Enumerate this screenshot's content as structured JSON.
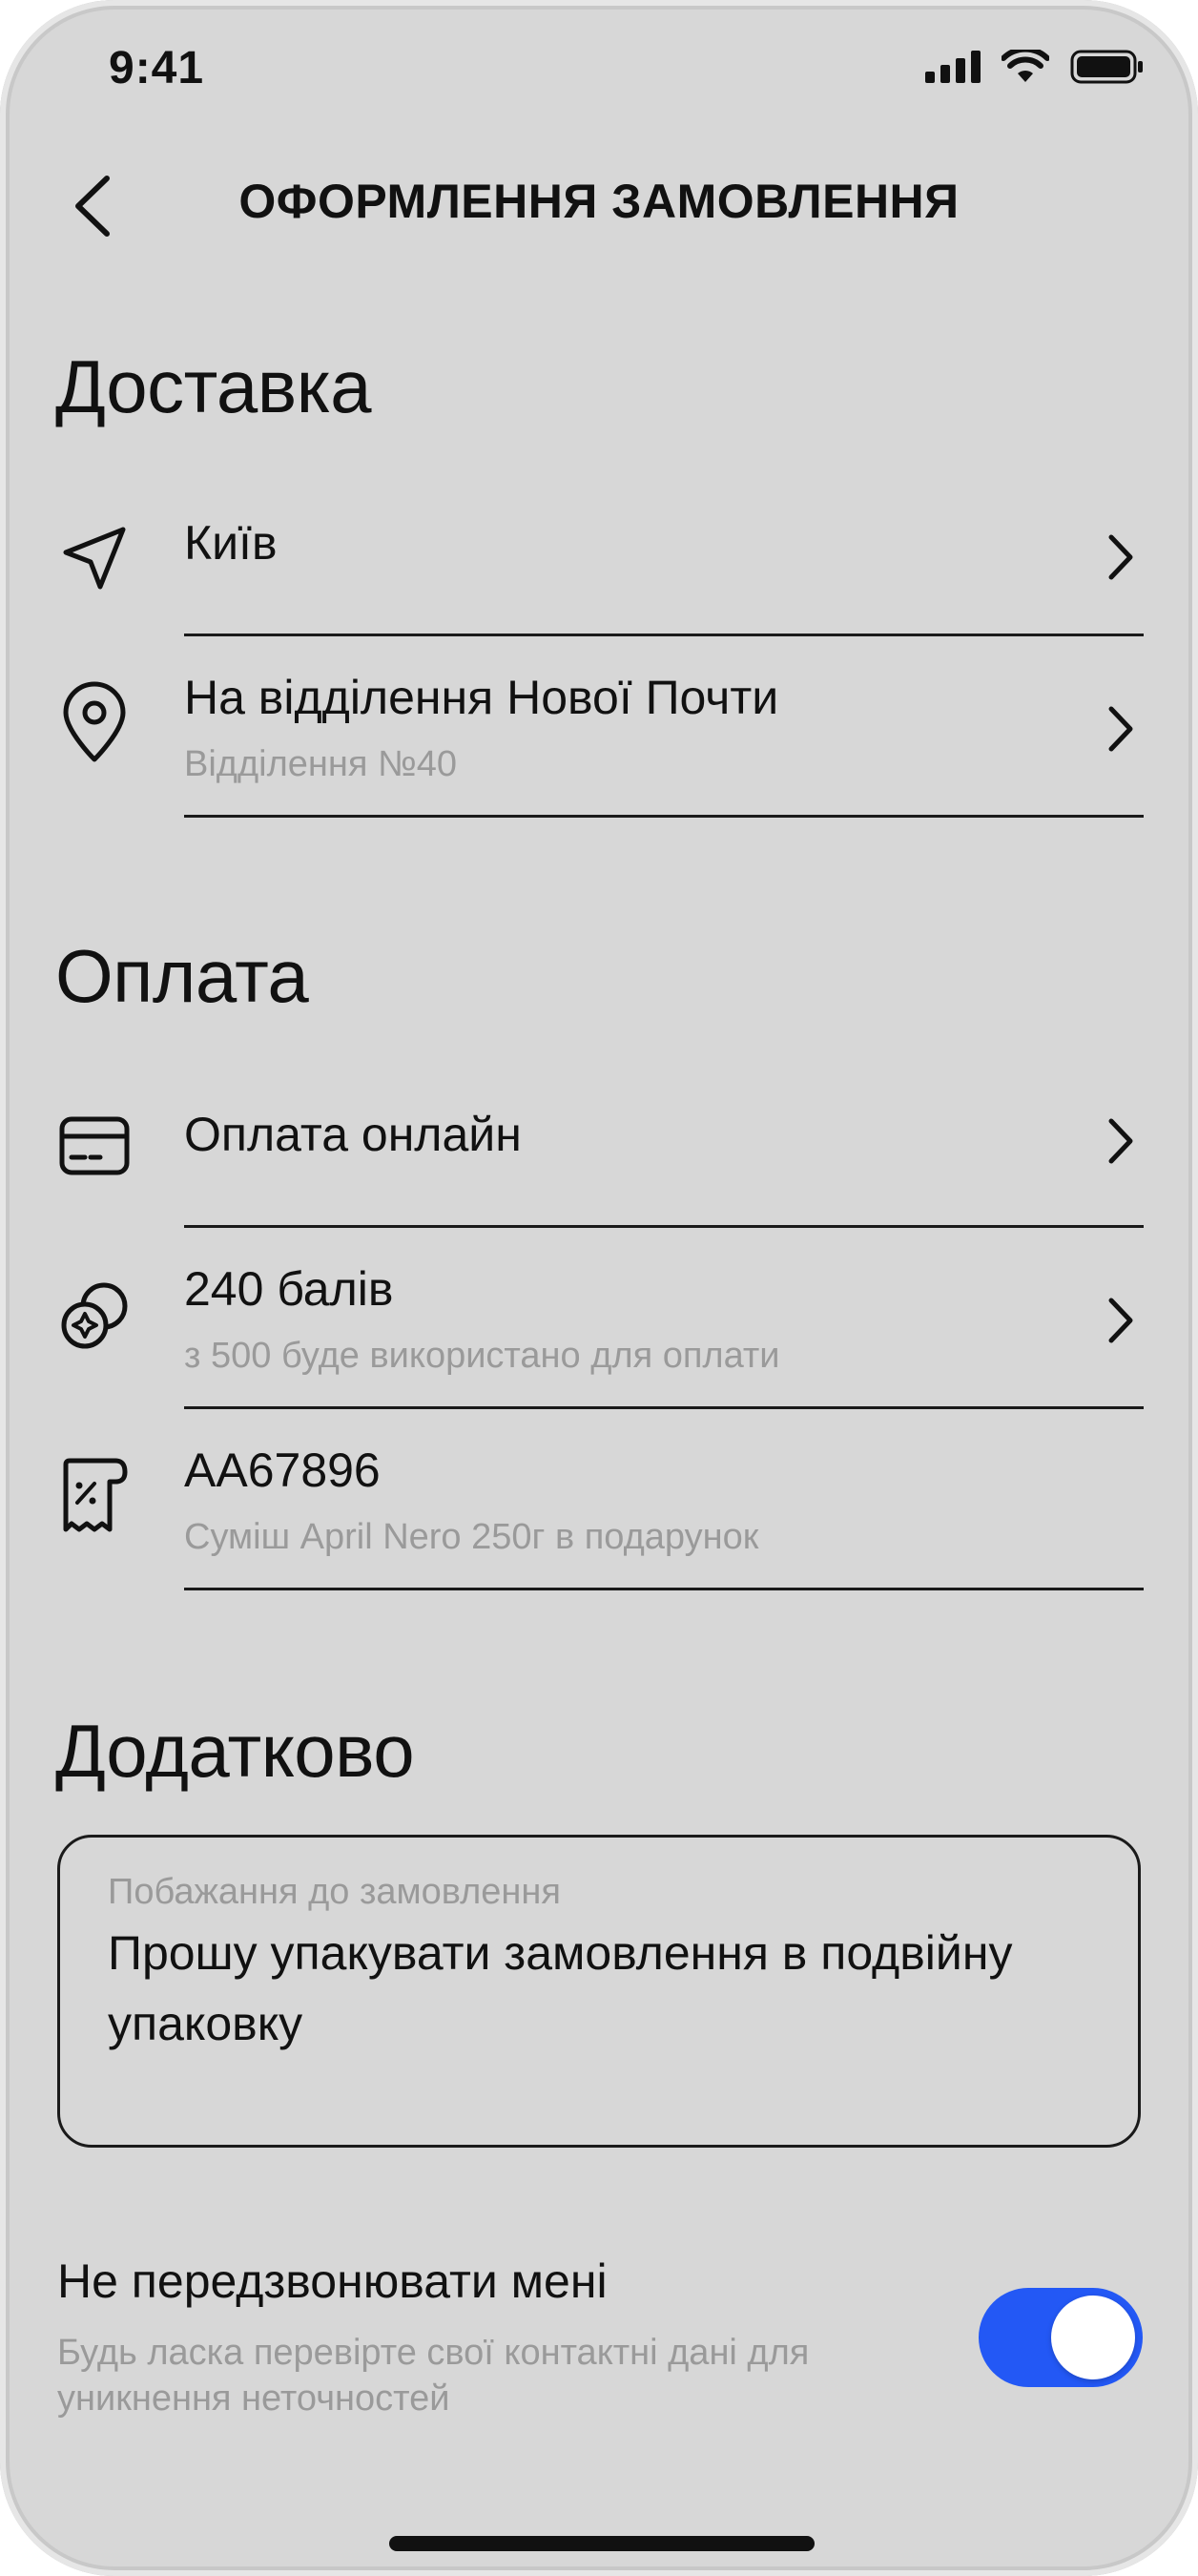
{
  "status_bar": {
    "time": "9:41"
  },
  "header": {
    "title": "ОФОРМЛЕННЯ ЗАМОВЛЕННЯ"
  },
  "delivery": {
    "section_title": "Доставка",
    "city": {
      "title": "Київ",
      "icon": "navigation-arrow-icon"
    },
    "method": {
      "title": "На відділення Нової Почти",
      "subtitle": "Відділення №40",
      "icon": "map-pin-icon"
    }
  },
  "payment": {
    "section_title": "Оплата",
    "method": {
      "title": "Оплата онлайн",
      "icon": "credit-card-icon"
    },
    "points": {
      "title": "240 балів",
      "subtitle": "з 500 буде використано для оплати",
      "icon": "coins-icon"
    },
    "promo": {
      "title": "AA67896",
      "subtitle": "Суміш April Nero 250г в подарунок",
      "icon": "receipt-discount-icon"
    }
  },
  "extra": {
    "section_title": "Додатково",
    "wish": {
      "label": "Побажання до замовлення",
      "value": "Прошу упакувати замовлення в подвійну упаковку"
    },
    "callback": {
      "title": "Не передзвонювати мені",
      "subtitle": "Будь ласка перевірте свої контактні дані для уникнення неточностей",
      "enabled": true
    }
  },
  "colors": {
    "background": "#d7d7d7",
    "accent": "#2358f5",
    "text_primary": "#111111",
    "text_secondary": "#9a9a9a",
    "divider": "#1a1a1a"
  }
}
